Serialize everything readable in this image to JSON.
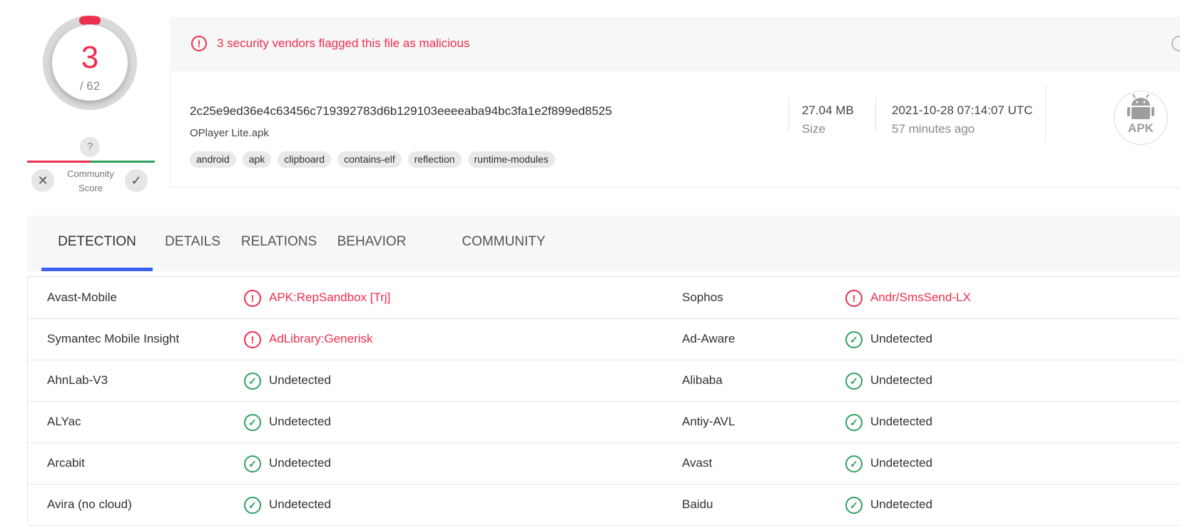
{
  "score": {
    "detections": "3",
    "total": "/ 62",
    "colors": {
      "malicious": "#ed2f4f",
      "ring": "#d9d9d9"
    },
    "detection_fraction": 0.048
  },
  "community": {
    "unknown_glyph": "?",
    "label_line1": "Community",
    "label_line2": "Score",
    "vote_bad_icon": "close-icon",
    "vote_good_icon": "check-icon"
  },
  "alert": {
    "icon": "exclamation-icon",
    "text": "3 security vendors flagged this file as malicious"
  },
  "file": {
    "hash": "2c25e9ed36e4c63456c719392783d6b129103eeeeaba94bc3fa1e2f899ed8525",
    "name": "OPlayer Lite.apk",
    "tags": [
      "android",
      "apk",
      "clipboard",
      "contains-elf",
      "reflection",
      "runtime-modules"
    ],
    "size_value": "27.04 MB",
    "size_label": "Size",
    "date_value": "2021-10-28 07:14:07 UTC",
    "date_ago": "57 minutes ago",
    "type_label": "APK",
    "type_icon": "android-icon"
  },
  "tabs": [
    {
      "label": "DETECTION",
      "active": true
    },
    {
      "label": "DETAILS",
      "active": false
    },
    {
      "label": "RELATIONS",
      "active": false
    },
    {
      "label": "BEHAVIOR",
      "active": false
    },
    {
      "label": "COMMUNITY",
      "active": false
    }
  ],
  "detections": [
    {
      "left": {
        "engine": "Avast-Mobile",
        "status": "malicious",
        "result": "APK:RepSandbox [Trj]"
      },
      "right": {
        "engine": "Sophos",
        "status": "malicious",
        "result": "Andr/SmsSend-LX"
      }
    },
    {
      "left": {
        "engine": "Symantec Mobile Insight",
        "status": "malicious",
        "result": "AdLibrary:Generisk"
      },
      "right": {
        "engine": "Ad-Aware",
        "status": "undetected",
        "result": "Undetected"
      }
    },
    {
      "left": {
        "engine": "AhnLab-V3",
        "status": "undetected",
        "result": "Undetected"
      },
      "right": {
        "engine": "Alibaba",
        "status": "undetected",
        "result": "Undetected"
      }
    },
    {
      "left": {
        "engine": "ALYac",
        "status": "undetected",
        "result": "Undetected"
      },
      "right": {
        "engine": "Antiy-AVL",
        "status": "undetected",
        "result": "Undetected"
      }
    },
    {
      "left": {
        "engine": "Arcabit",
        "status": "undetected",
        "result": "Undetected"
      },
      "right": {
        "engine": "Avast",
        "status": "undetected",
        "result": "Undetected"
      }
    },
    {
      "left": {
        "engine": "Avira (no cloud)",
        "status": "undetected",
        "result": "Undetected"
      },
      "right": {
        "engine": "Baidu",
        "status": "undetected",
        "result": "Undetected"
      }
    }
  ]
}
